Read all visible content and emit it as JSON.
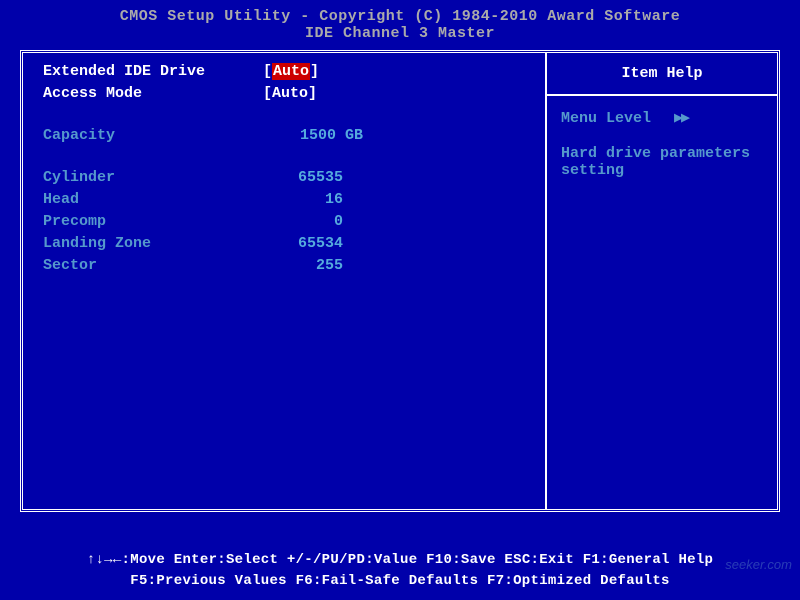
{
  "title": {
    "line1": "CMOS Setup Utility - Copyright (C) 1984-2010 Award Software",
    "line2": "IDE Channel 3 Master"
  },
  "settings": {
    "extended_ide_drive": {
      "label": "Extended IDE Drive",
      "value": "Auto"
    },
    "access_mode": {
      "label": "Access Mode",
      "value": "Auto"
    },
    "capacity": {
      "label": "Capacity",
      "value": "1500 GB"
    },
    "cylinder": {
      "label": "Cylinder",
      "value": "65535"
    },
    "head": {
      "label": "Head",
      "value": "16"
    },
    "precomp": {
      "label": "Precomp",
      "value": "0"
    },
    "landing_zone": {
      "label": "Landing Zone",
      "value": "65534"
    },
    "sector": {
      "label": "Sector",
      "value": "255"
    }
  },
  "help": {
    "title": "Item Help",
    "menu_level_label": "Menu Level",
    "arrows": "▶▶",
    "description": "Hard drive parameters setting"
  },
  "footer": {
    "line1": "↑↓→←:Move  Enter:Select  +/-/PU/PD:Value  F10:Save  ESC:Exit  F1:General Help",
    "line2": "F5:Previous Values  F6:Fail-Safe Defaults  F7:Optimized Defaults"
  },
  "watermark": "seeker.com"
}
